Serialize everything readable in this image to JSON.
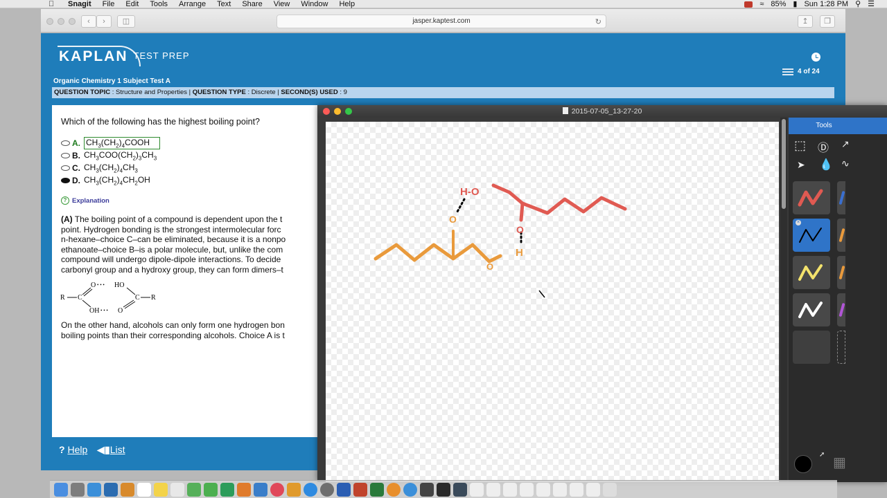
{
  "menubar": {
    "menus": [
      "Snagit",
      "File",
      "Edit",
      "Tools",
      "Arrange",
      "Text",
      "Share",
      "View",
      "Window",
      "Help"
    ],
    "battery": "85%",
    "clock": "Sun 1:28 PM"
  },
  "browser": {
    "url": "jasper.kaptest.com"
  },
  "kaplan": {
    "logo": "KAPLAN",
    "logo_sub": "TEST PREP",
    "test_title": "Organic Chemistry 1 Subject Test A",
    "progress": "4 of 24",
    "topic_bar": {
      "topic_label": "QUESTION TOPIC",
      "topic": "Structure and Properties",
      "type_label": "QUESTION TYPE",
      "type": "Discrete",
      "seconds_label": "SECOND(S) USED",
      "seconds": "9"
    },
    "question": "Which of the following has the highest boiling point?",
    "choices": [
      {
        "letter": "A.",
        "parts": [
          "CH",
          "3",
          "(CH",
          "2",
          ")",
          "4",
          "COOH"
        ]
      },
      {
        "letter": "B.",
        "parts": [
          "CH",
          "3",
          "COO(CH",
          "2",
          ")",
          "3",
          "CH",
          "3"
        ]
      },
      {
        "letter": "C.",
        "parts": [
          "CH",
          "3",
          "(CH",
          "2",
          ")",
          "4",
          "CH",
          "3"
        ]
      },
      {
        "letter": "D.",
        "parts": [
          "CH",
          "3",
          "(CH",
          "2",
          ")",
          "4",
          "CH",
          "2",
          "OH"
        ]
      }
    ],
    "explanation_label": "Explanation",
    "answer_letter": "(A)",
    "explanation_lines": [
      " The boiling point of a compound is dependent upon the t",
      "point. Hydrogen bonding is the strongest intermolecular forc",
      "n-hexane–choice C–can be eliminated, because it is a nonpo",
      "ethanoate–choice B–is a polar molecule, but, unlike the com",
      "compound will undergo dipole-dipole interactions. To decide",
      "carbonyl group and a hydroxy group, they can form dimers–t"
    ],
    "dimer": {
      "r_left": "R",
      "c_left": "C",
      "o_top": "O",
      "dots_top": "• • •",
      "ho": "HO",
      "oh": "OH",
      "dots_bottom": "• • •",
      "o_bottom": "O",
      "c_right": "C",
      "r_right": "R"
    },
    "conclusion_lines": [
      "On the other hand, alcohols can only form one hydrogen bon",
      "boiling points than their corresponding alcohols. Choice A is t"
    ],
    "footer": {
      "help": "Help",
      "list": "List"
    }
  },
  "snagit": {
    "title": "2015-07-05_13-27-20",
    "tools_header": "Tools",
    "drawing_labels": {
      "oh_top": "H-O",
      "o_right": "O",
      "o_left": "O",
      "h_right": "H",
      "o_bottom": "O"
    },
    "colors": {
      "red": "#e05a52",
      "orange": "#e99a3c",
      "yellow": "#f3e26c",
      "white": "#ffffff",
      "blue": "#2f74c8"
    }
  }
}
